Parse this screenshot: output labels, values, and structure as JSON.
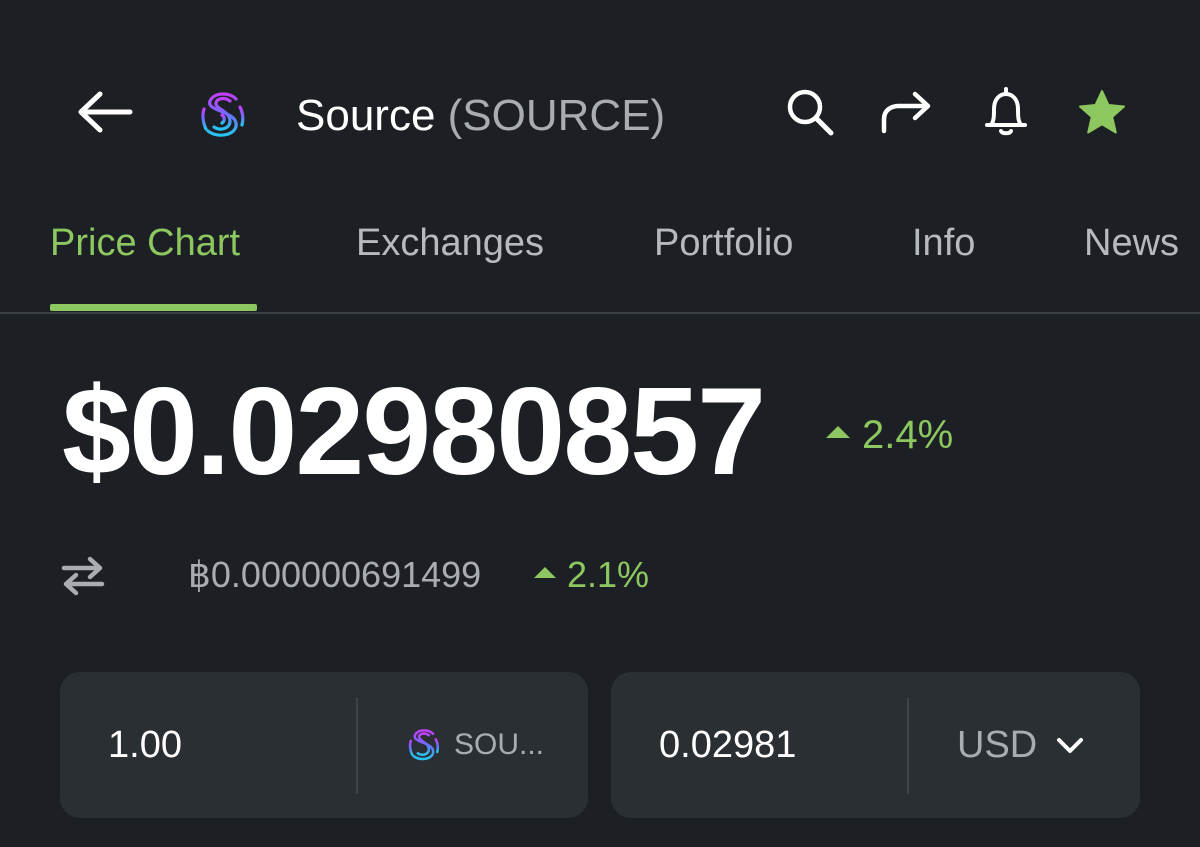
{
  "header": {
    "coin_name": "Source",
    "coin_symbol": "(SOURCE)",
    "star_color": "#8dc75f",
    "icons": [
      "back-arrow-icon",
      "source-logo-icon",
      "search-icon",
      "share-icon",
      "bell-icon",
      "star-icon"
    ]
  },
  "tabs": [
    {
      "label": "Price Chart",
      "active": true
    },
    {
      "label": "Exchanges",
      "active": false
    },
    {
      "label": "Portfolio",
      "active": false
    },
    {
      "label": "Info",
      "active": false
    },
    {
      "label": "News",
      "active": false
    }
  ],
  "price": {
    "usd": "$0.02980857",
    "usd_change": "2.4%",
    "btc": "฿0.000000691499",
    "btc_change": "2.1%",
    "up_color": "#8dc75f"
  },
  "converter": {
    "amount": "1.00",
    "token_label": "SOU...",
    "converted_value": "0.02981",
    "currency": "USD"
  }
}
